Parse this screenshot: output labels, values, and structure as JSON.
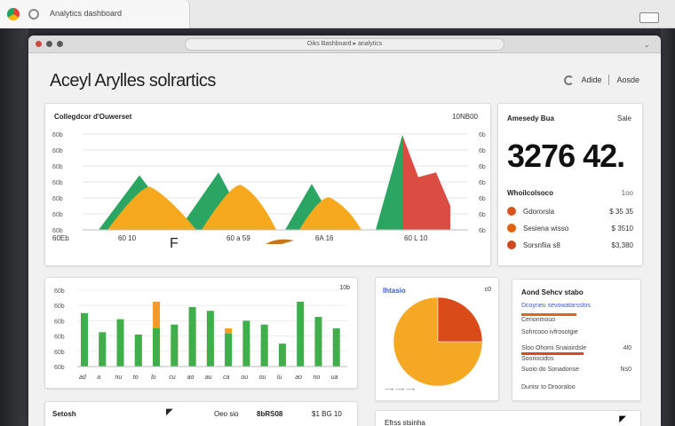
{
  "browser": {
    "tab_title": "Analytics dashboard",
    "url": "Oiks Bashboard ▸ analytics"
  },
  "page": {
    "title": "Aceyl Arylles solrartics",
    "top_right": {
      "link1": "Adide",
      "link2": "Aosde"
    }
  },
  "area_chart": {
    "title": "Collegdcor d'Ouwerset",
    "right_label": "10NB00",
    "y_ticks_left": [
      "60b",
      "60b",
      "60b",
      "60b",
      "60b",
      "60b",
      "60b"
    ],
    "y_ticks_right": [
      "6b",
      "6b",
      "6b",
      "6b",
      "6b",
      "6b",
      "6b"
    ],
    "x_labels": [
      "60Eb",
      "60 10",
      "60 a 59",
      "6A 16",
      "60 L 10"
    ],
    "marker_letter": "F",
    "colors": {
      "green": "#2aa562",
      "orange": "#f6a91c",
      "red": "#db4c43"
    }
  },
  "chart_data": [
    {
      "type": "area",
      "title": "Collegdcor d'Ouwerset",
      "xlabel": "",
      "ylabel": "",
      "series": [
        {
          "name": "",
          "color": "#2aa562",
          "peaks": [
            0.57,
            0.6,
            0.48,
            0.99
          ]
        },
        {
          "name": "",
          "color": "#f6a91c",
          "peaks": [
            0.45,
            0.47,
            0.34
          ]
        },
        {
          "name": "",
          "color": "#db4c43",
          "peaks": [
            0.99
          ]
        }
      ]
    },
    {
      "type": "bar",
      "title": "",
      "categories": [
        "ad",
        "a",
        "nu",
        "to",
        "lo",
        "cu",
        "ao",
        "au",
        "ca",
        "ou",
        "ou",
        "lu",
        "ao",
        "no",
        "ua"
      ],
      "series": [
        {
          "name": "",
          "color": "#3fae4b",
          "values": [
            0.7,
            0.45,
            0.62,
            0.42,
            0.5,
            0.55,
            0.78,
            0.73,
            0.43,
            0.6,
            0.55,
            0.3,
            0.85,
            0.65,
            0.5
          ]
        },
        {
          "name": "",
          "color": "#f29a2a",
          "values": [
            0.55,
            0.38,
            0.0,
            0.35,
            0.85,
            0.4,
            0.6,
            0.24,
            0.5,
            0.3,
            0.33,
            0.05,
            0.0,
            0.42,
            0.0
          ]
        }
      ]
    },
    {
      "type": "pie",
      "title": "",
      "slices": [
        {
          "label": "",
          "value": 0.75,
          "color": "#f4a823"
        },
        {
          "label": "",
          "value": 0.25,
          "color": "#d94c1a"
        }
      ]
    }
  ],
  "bar_chart": {
    "y_ticks": [
      "60b",
      "60b",
      "60b",
      "60b",
      "60b",
      "60b"
    ],
    "right_label": "10b",
    "x_labels": [
      "ad",
      "a",
      "nu",
      "to",
      "lo",
      "cu",
      "ao",
      "au",
      "ca",
      "ou",
      "ou",
      "lu",
      "ao",
      "no",
      "ua"
    ]
  },
  "kpi": {
    "title": "Amesedy Bua",
    "title_right": "Sale",
    "value": "3276 42.",
    "sub_title": "Whoilcolsoco",
    "sub_right": "1oo",
    "rows": [
      {
        "label": "Gdororsla",
        "value": "$ 35 35",
        "color": "#d9531e"
      },
      {
        "label": "Sesiena wisso",
        "value": "$ 3510",
        "color": "#e1620f"
      },
      {
        "label": "Sorsnfiia s8",
        "value": "$3,380",
        "color": "#cf4a1c"
      }
    ]
  },
  "pie_card": {
    "title": "Ihtasio",
    "title_right": "c0",
    "legend": "⟶ ⟶ ⟶"
  },
  "legend_card": {
    "title": "Aond Sehcv stabo",
    "line1": "Dcoyneu sevowatarsstos",
    "line2": "Cerionmouo",
    "line3": "Sohrcooo ivfrosotgie",
    "line4": "Sloo Ohomi Snaioirdsle",
    "line4_value": "4l0",
    "line5": "Sooriocidos",
    "line6": "Suoio do Sonadonse",
    "line6_value": "Ns0",
    "line7": "Dunisr to Drooraloo"
  },
  "bottom_left": {
    "col1": "Setosh",
    "col2": "Oeo sio",
    "col3": "8bRS08",
    "col4": "$1 BG 10"
  },
  "bottom_right": {
    "title": "Efrss stsinha"
  }
}
